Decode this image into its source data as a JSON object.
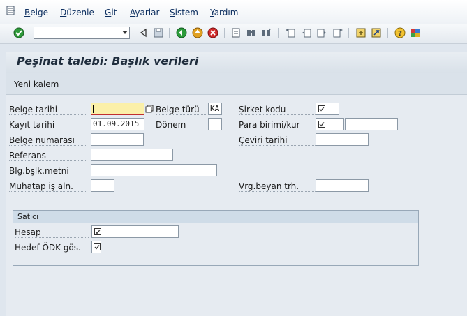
{
  "menu": {
    "items": [
      {
        "label": "Belge",
        "u": "B",
        "rest": "elge"
      },
      {
        "label": "Düzenle",
        "u": "D",
        "rest": "üzenle"
      },
      {
        "label": "Git",
        "u": "G",
        "rest": "it"
      },
      {
        "label": "Ayarlar",
        "u": "A",
        "rest": "yarlar"
      },
      {
        "label": "Sistem",
        "u": "S",
        "rest": "istem"
      },
      {
        "label": "Yardım",
        "u": "Y",
        "rest": "ardım"
      }
    ]
  },
  "toolbar": {
    "command_field_value": "",
    "icons": [
      "enter-icon",
      "back-triangle-icon",
      "save-icon",
      "back-icon",
      "exit-icon",
      "cancel-icon",
      "print-icon",
      "find-icon",
      "find-next-icon",
      "first-page-icon",
      "previous-page-icon",
      "next-page-icon",
      "last-page-icon",
      "new-session-icon",
      "shortcut-icon",
      "help-icon",
      "layout-icon"
    ]
  },
  "header": {
    "title": "Peşinat talebi: Başlık verileri",
    "new_item_label": "Yeni kalem"
  },
  "form": {
    "belge_tarihi": {
      "label": "Belge tarihi",
      "value": ""
    },
    "belge_turu": {
      "label": "Belge türü",
      "value": "KA"
    },
    "sirket_kodu": {
      "label": "Şirket kodu",
      "checked": true
    },
    "kayit_tarihi": {
      "label": "Kayıt tarihi",
      "value": "01.09.2015"
    },
    "donem": {
      "label": "Dönem",
      "value": ""
    },
    "para_birimi": {
      "label": "Para birimi/kur",
      "checked": true,
      "rate": ""
    },
    "belge_numarasi": {
      "label": "Belge numarası",
      "value": ""
    },
    "ceviri_tarihi": {
      "label": "Çeviri tarihi",
      "value": ""
    },
    "referans": {
      "label": "Referans",
      "value": ""
    },
    "blg_bslk_metni": {
      "label": "Blg.bşlk.metni",
      "value": ""
    },
    "muhatap": {
      "label": "Muhatap iş aln.",
      "value": ""
    },
    "vrg_beyan": {
      "label": "Vrg.beyan trh.",
      "value": ""
    }
  },
  "vendor": {
    "title": "Satıcı",
    "hesap": {
      "label": "Hesap",
      "checked": true
    },
    "hedef_odk": {
      "label": "Hedef ÖDK gös.",
      "checked": true
    }
  }
}
